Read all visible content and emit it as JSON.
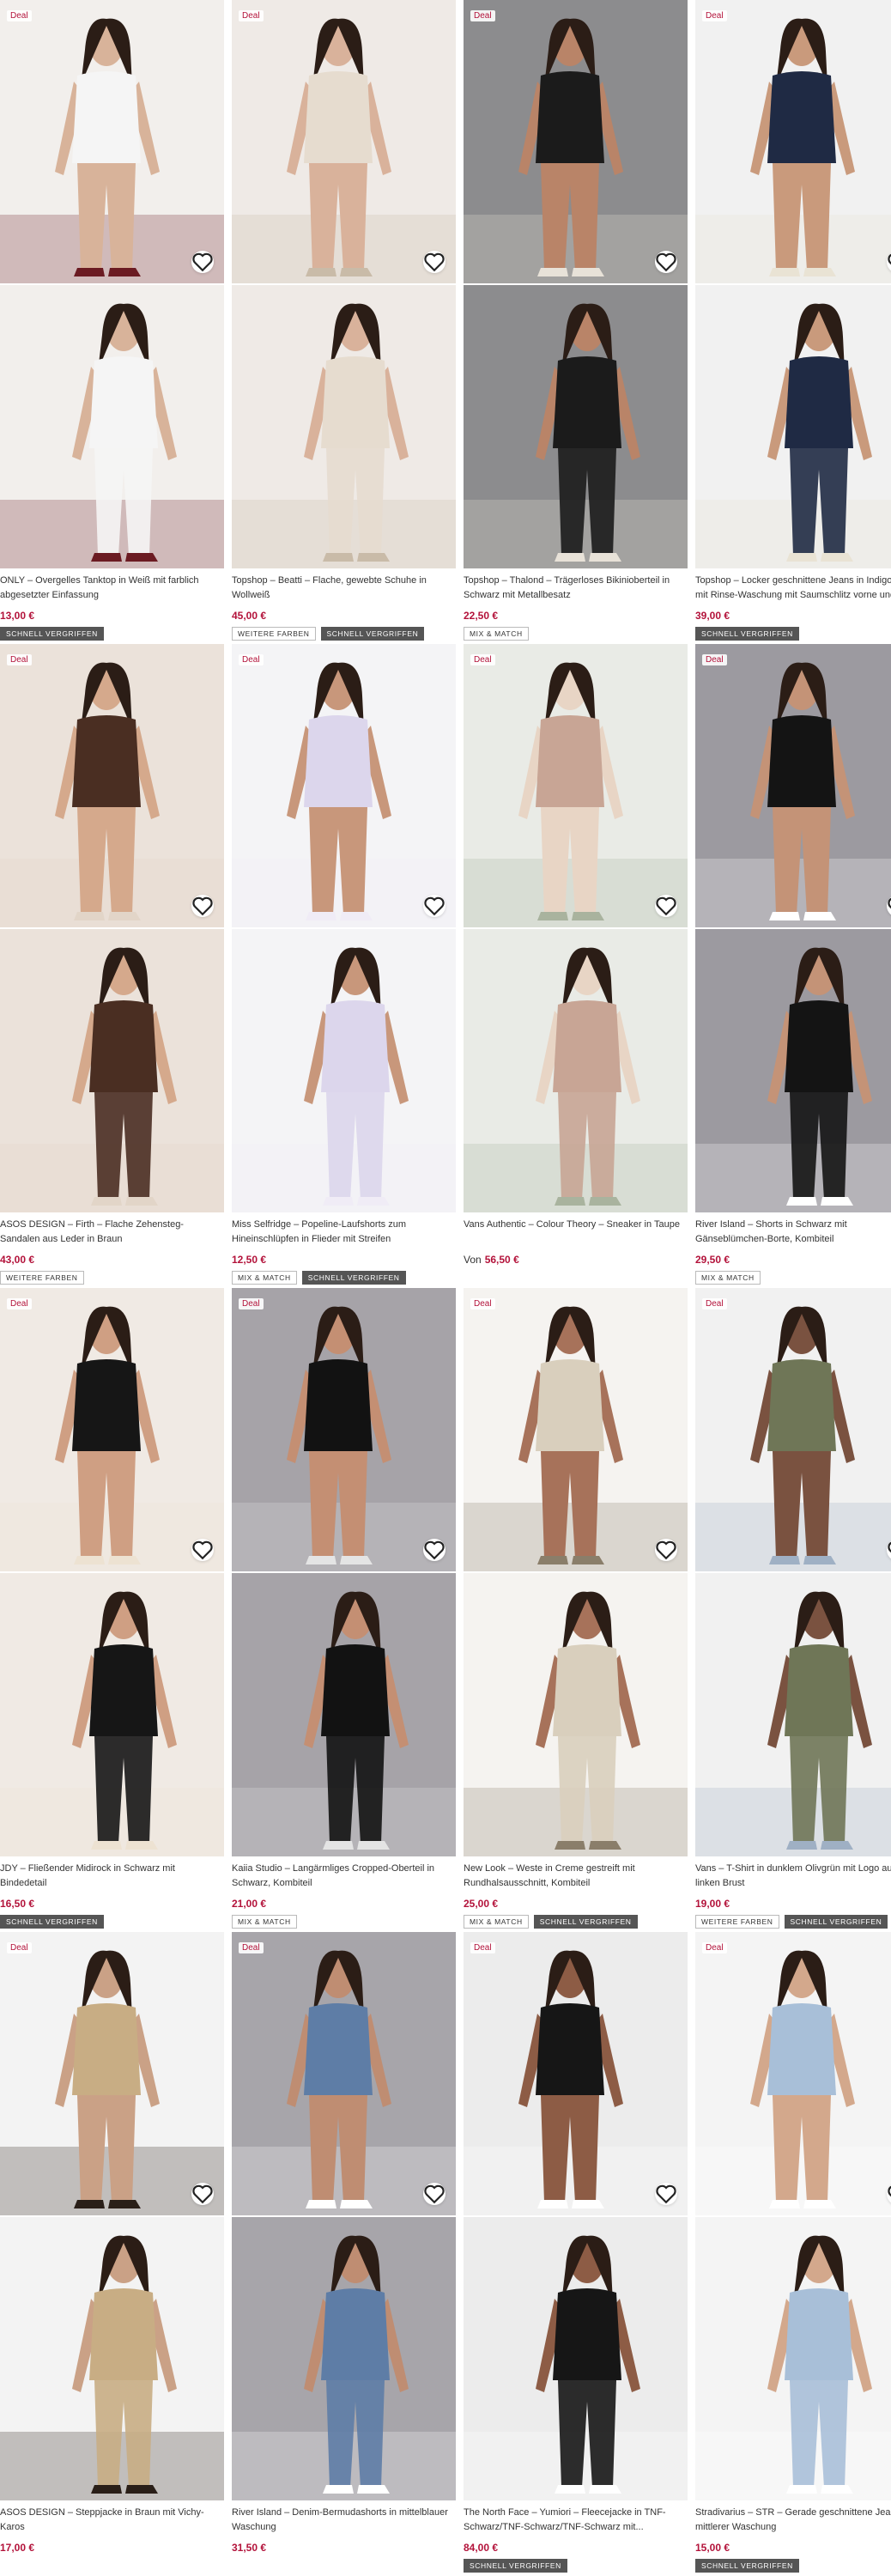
{
  "colors": {
    "price": "#b3123a",
    "deal": "#b3123a",
    "badge_dark": "#555555"
  },
  "products": [
    {
      "deal": "Deal",
      "title": "ONLY – Overgelles Tanktop in Weiß mit farblich abgesetzter Einfassung",
      "price": "13,00 €",
      "from": "",
      "badges": [
        "SCHNELL VERGRIFFEN"
      ],
      "bg": "#f2efec",
      "fig": "#d8b39a",
      "cloth": "#f5f5f5",
      "accent": "#6b1b22"
    },
    {
      "deal": "Deal",
      "title": "Topshop – Beatti – Flache, gewebte Schuhe in Wollweiß",
      "price": "45,00 €",
      "from": "",
      "badges": [
        "WEITERE FARBEN",
        "SCHNELL VERGRIFFEN"
      ],
      "bg": "#efeae6",
      "fig": "#d9b29b",
      "cloth": "#e6dccf",
      "accent": "#c9bba8"
    },
    {
      "deal": "Deal",
      "title": "Topshop – Thalond – Trägerloses Bikinioberteil in Schwarz mit Metallbesatz",
      "price": "22,50 €",
      "from": "",
      "badges": [
        "MIX & MATCH"
      ],
      "bg": "#8c8c8e",
      "fig": "#b98468",
      "cloth": "#1b1b1b",
      "accent": "#e8e2d8"
    },
    {
      "deal": "Deal",
      "title": "Topshop – Locker geschnittene Jeans in Indigoblau mit Rinse-Waschung mit Saumschlitz vorne und...",
      "price": "39,00 €",
      "from": "",
      "badges": [
        "SCHNELL VERGRIFFEN"
      ],
      "bg": "#f1f1f1",
      "fig": "#c99a7c",
      "cloth": "#1f2a44",
      "accent": "#e9e3d4"
    },
    {
      "deal": "Deal",
      "title": "ASOS DESIGN – Firth – Flache Zehensteg-Sandalen aus Leder in Braun",
      "price": "43,00 €",
      "from": "",
      "badges": [
        "WEITERE FARBEN"
      ],
      "bg": "#ebe2da",
      "fig": "#d5a98c",
      "cloth": "#4a2e22",
      "accent": "#e2d5c8"
    },
    {
      "deal": "Deal",
      "title": "Miss Selfridge – Popeline-Laufshorts zum Hineinschlüpfen in Flieder mit Streifen",
      "price": "12,50 €",
      "from": "",
      "badges": [
        "MIX & MATCH",
        "SCHNELL VERGRIFFEN"
      ],
      "bg": "#f4f4f6",
      "fig": "#c8977b",
      "cloth": "#dcd6ec",
      "accent": "#f0ecf6"
    },
    {
      "deal": "Deal",
      "title": "Vans Authentic – Colour Theory – Sneaker in Taupe",
      "price": "56,50 €",
      "from": "Von",
      "badges": [],
      "bg": "#e9ebe6",
      "fig": "#e8d5c5",
      "cloth": "#c8a595",
      "accent": "#a9b39e"
    },
    {
      "deal": "Deal",
      "title": "River Island – Shorts in Schwarz mit Gänseblümchen-Borte, Kombiteil",
      "price": "29,50 €",
      "from": "",
      "badges": [
        "MIX & MATCH"
      ],
      "bg": "#9c9aa0",
      "fig": "#c49377",
      "cloth": "#141414",
      "accent": "#ffffff"
    },
    {
      "deal": "Deal",
      "title": "JDY – Fließender Midirock in Schwarz mit Bindedetail",
      "price": "16,50 €",
      "from": "",
      "badges": [
        "SCHNELL VERGRIFFEN"
      ],
      "bg": "#f0eae4",
      "fig": "#cf9f83",
      "cloth": "#161616",
      "accent": "#ede2d2"
    },
    {
      "deal": "Deal",
      "title": "Kaiia Studio – Langärmliges Cropped-Oberteil in Schwarz, Kombiteil",
      "price": "21,00 €",
      "from": "",
      "badges": [
        "MIX & MATCH"
      ],
      "bg": "#a6a3a8",
      "fig": "#c48f73",
      "cloth": "#121212",
      "accent": "#e4e4e4"
    },
    {
      "deal": "Deal",
      "title": "New Look – Weste in Creme gestreift mit Rundhalsausschnitt, Kombiteil",
      "price": "25,00 €",
      "from": "",
      "badges": [
        "MIX & MATCH",
        "SCHNELL VERGRIFFEN"
      ],
      "bg": "#f5f3f0",
      "fig": "#a7725a",
      "cloth": "#d9cfbd",
      "accent": "#8a7e6a"
    },
    {
      "deal": "Deal",
      "title": "Vans – T-Shirt in dunklem Olivgrün mit Logo auf der linken Brust",
      "price": "19,00 €",
      "from": "",
      "badges": [
        "WEITERE FARBEN",
        "SCHNELL VERGRIFFEN"
      ],
      "bg": "#f1f1f1",
      "fig": "#7a5240",
      "cloth": "#6f7657",
      "accent": "#9fb0c4"
    },
    {
      "deal": "Deal",
      "title": "ASOS DESIGN – Steppjacke in Braun mit Vichy-Karos",
      "price": "17,00 €",
      "from": "",
      "badges": [],
      "bg": "#f3f3f3",
      "fig": "#caa186",
      "cloth": "#c8ad84",
      "accent": "#2a1f18"
    },
    {
      "deal": "Deal",
      "title": "River Island – Denim-Bermudashorts in mittelblauer Waschung",
      "price": "31,50 €",
      "from": "",
      "badges": [],
      "bg": "#a7a5aa",
      "fig": "#bf8d72",
      "cloth": "#5e7da6",
      "accent": "#ffffff"
    },
    {
      "deal": "Deal",
      "title": "The North Face – Yumiori – Fleecejacke in TNF-Schwarz/TNF-Schwarz/TNF-Schwarz mit...",
      "price": "84,00 €",
      "from": "",
      "badges": [
        "SCHNELL VERGRIFFEN"
      ],
      "bg": "#ececec",
      "fig": "#8d5c45",
      "cloth": "#161616",
      "accent": "#ffffff"
    },
    {
      "deal": "Deal",
      "title": "Stradivarius – STR – Gerade geschnittene Jeans in mittlerer Waschung",
      "price": "15,00 €",
      "from": "",
      "badges": [
        "SCHNELL VERGRIFFEN"
      ],
      "bg": "#f4f4f4",
      "fig": "#d3a88c",
      "cloth": "#a8bfd8",
      "accent": "#ffffff"
    }
  ]
}
